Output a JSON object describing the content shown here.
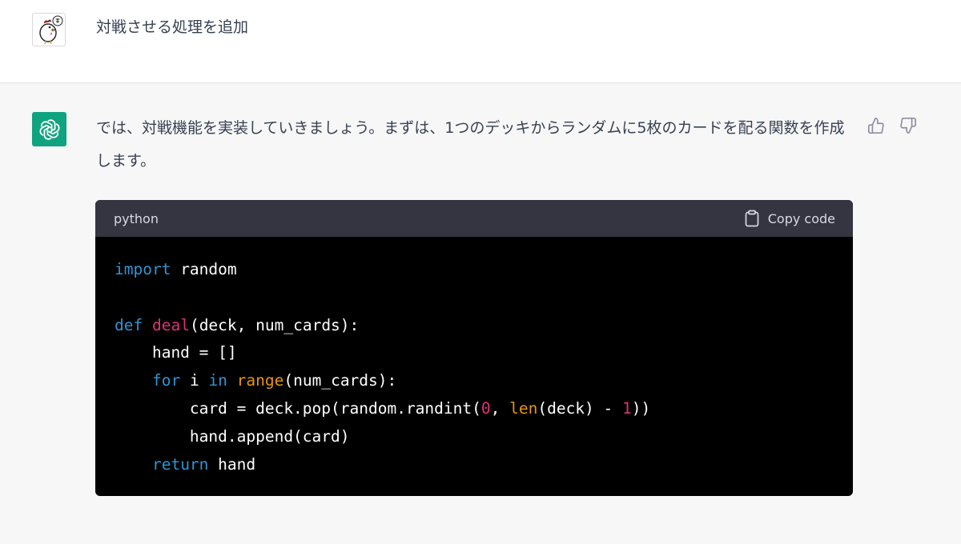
{
  "user_message": {
    "text": "対戦させる処理を追加"
  },
  "assistant_message": {
    "text": "では、対戦機能を実装していきましょう。まずは、1つのデッキからランダムに5枚のカードを配る関数を作成します。"
  },
  "code_block": {
    "language": "python",
    "copy_label": "Copy code",
    "lines": {
      "l1": {
        "kw_import": "import",
        "t1": " random"
      },
      "l3": {
        "kw_def": "def",
        "sp": " ",
        "fn_deal": "deal",
        "t1": "(deck, num_cards):"
      },
      "l4": {
        "t1": "    hand = []"
      },
      "l5": {
        "ind": "    ",
        "kw_for": "for",
        "t1": " i ",
        "kw_in": "in",
        "sp": " ",
        "bi_range": "range",
        "t2": "(num_cards):"
      },
      "l6": {
        "t1": "        card = deck.pop(random.randint(",
        "num0": "0",
        "t2": ", ",
        "bi_len": "len",
        "t3": "(deck) - ",
        "num1": "1",
        "t4": "))"
      },
      "l7": {
        "t1": "        hand.append(card)"
      },
      "l8": {
        "ind": "    ",
        "kw_return": "return",
        "t1": " hand"
      }
    }
  },
  "colors": {
    "accent_green": "#10a37f",
    "code_background": "#000000",
    "code_header": "#343541",
    "keyword": "#2e95d3",
    "function_name": "#df3079",
    "builtin": "#e9950c"
  },
  "icons": {
    "user_avatar": "chicken-avatar-icon",
    "assistant_avatar": "openai-logo-icon",
    "like": "thumbs-up-icon",
    "dislike": "thumbs-down-icon",
    "copy": "clipboard-icon"
  }
}
